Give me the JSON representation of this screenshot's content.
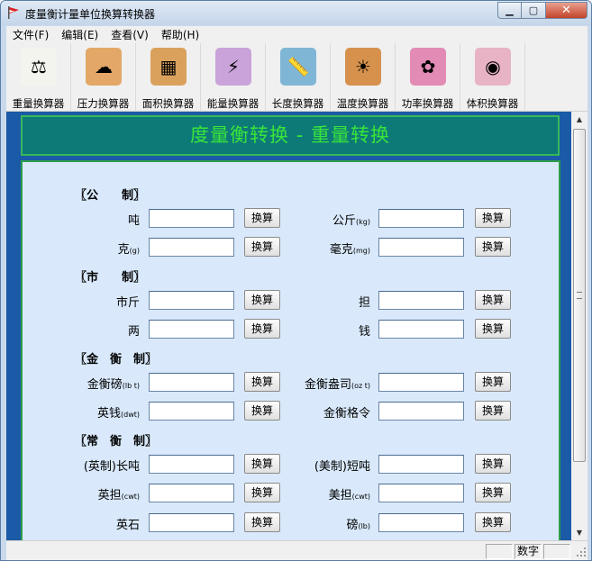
{
  "window": {
    "title": "度量衡计量单位换算转换器"
  },
  "menu": [
    "文件(F)",
    "编辑(E)",
    "查看(V)",
    "帮助(H)"
  ],
  "toolbar": [
    {
      "label": "重量换算器",
      "icon": "scale-icon",
      "color": "#f4f4ee"
    },
    {
      "label": "压力换算器",
      "icon": "pressure-icon",
      "color": "#e3a867"
    },
    {
      "label": "面积换算器",
      "icon": "area-icon",
      "color": "#d9a15c"
    },
    {
      "label": "能量换算器",
      "icon": "energy-icon",
      "color": "#c9a3d9"
    },
    {
      "label": "长度换算器",
      "icon": "length-icon",
      "color": "#7fb6d6"
    },
    {
      "label": "温度换算器",
      "icon": "temperature-icon",
      "color": "#d6924d"
    },
    {
      "label": "功率换算器",
      "icon": "power-icon",
      "color": "#e28bb5"
    },
    {
      "label": "体积换算器",
      "icon": "volume-icon",
      "color": "#e8b3c4"
    }
  ],
  "header": {
    "title": "度量衡转换 - 重量转换"
  },
  "convert_label": "换算",
  "sections": [
    {
      "title": "〖公　　制〗"
    },
    {
      "title": "〖市　　制〗"
    },
    {
      "title": "〖金　衡　制〗"
    },
    {
      "title": "〖常　衡　制〗"
    }
  ],
  "rows": [
    {
      "left": {
        "name": "吨",
        "unit": ""
      },
      "right": {
        "name": "公斤",
        "unit": "(kg)"
      }
    },
    {
      "left": {
        "name": "克",
        "unit": "(g)"
      },
      "right": {
        "name": "毫克",
        "unit": "(mg)"
      }
    },
    {
      "left": {
        "name": "市斤",
        "unit": ""
      },
      "right": {
        "name": "担",
        "unit": ""
      }
    },
    {
      "left": {
        "name": "两",
        "unit": ""
      },
      "right": {
        "name": "钱",
        "unit": ""
      }
    },
    {
      "left": {
        "name": "金衡磅",
        "unit": "(lb t)"
      },
      "right": {
        "name": "金衡盎司",
        "unit": "(oz t)"
      }
    },
    {
      "left": {
        "name": "英钱",
        "unit": "(dwt)"
      },
      "right": {
        "name": "金衡格令",
        "unit": ""
      }
    },
    {
      "left": {
        "name": "(英制)长吨",
        "unit": ""
      },
      "right": {
        "name": "(美制)短吨",
        "unit": ""
      }
    },
    {
      "left": {
        "name": "英担",
        "unit": "(cwt)"
      },
      "right": {
        "name": "美担",
        "unit": "(cwt)"
      }
    },
    {
      "left": {
        "name": "英石",
        "unit": ""
      },
      "right": {
        "name": "磅",
        "unit": "(lb)"
      }
    }
  ],
  "status": {
    "num_lock": "数字"
  }
}
